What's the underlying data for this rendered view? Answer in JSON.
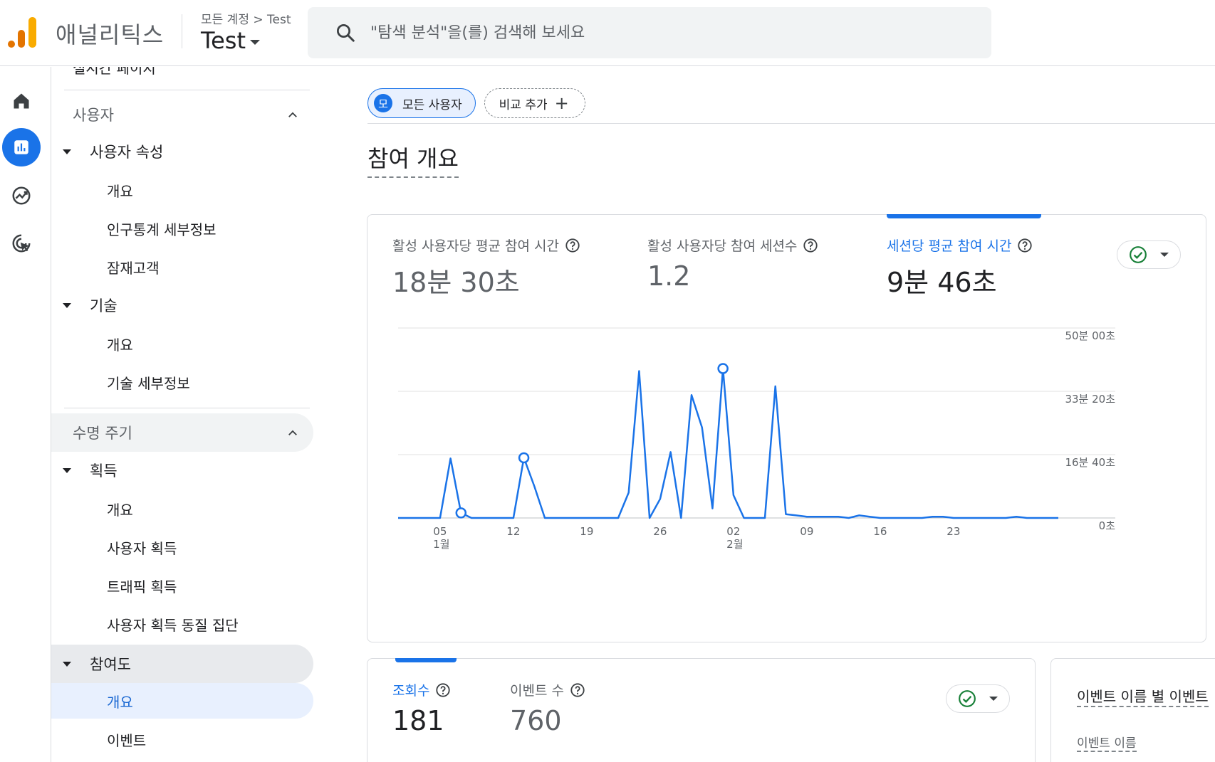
{
  "header": {
    "product_name": "애널리틱스",
    "breadcrumb_root": "모든 계정",
    "breadcrumb_separator": ">",
    "breadcrumb_account": "Test",
    "property_name": "Test",
    "search_placeholder": "\"탐색 분석\"을(를) 검색해 보세요"
  },
  "rail": {
    "items": [
      {
        "icon": "home-icon"
      },
      {
        "icon": "reports-icon",
        "active": true
      },
      {
        "icon": "explore-icon"
      },
      {
        "icon": "advertising-icon"
      }
    ]
  },
  "nav": {
    "cut_item": "실시간 페이지",
    "section_user": "사용자",
    "group_user_attributes": "사용자 속성",
    "user_attr_items": [
      "개요",
      "인구통계 세부정보",
      "잠재고객"
    ],
    "group_tech": "기술",
    "tech_items": [
      "개요",
      "기술 세부정보"
    ],
    "section_lifecycle": "수명 주기",
    "group_acquisition": "획득",
    "acq_items": [
      "개요",
      "사용자 획득",
      "트래픽 획득",
      "사용자 획득 동질 집단"
    ],
    "group_engagement": "참여도",
    "engagement_items": [
      "개요",
      "이벤트"
    ]
  },
  "main": {
    "chip_all_avatar": "모",
    "chip_all_label": "모든 사용자",
    "chip_add_label": "비교 추가",
    "chip_add_plus": "+",
    "page_title": "참여 개요"
  },
  "card1": {
    "metrics": [
      {
        "title": "활성 사용자당 평균 참여 시간",
        "value": "18분 30초"
      },
      {
        "title": "활성 사용자당 참여 세션수",
        "value": "1.2"
      },
      {
        "title": "세션당 평균 참여 시간",
        "value": "9분 46초",
        "selected": true
      }
    ]
  },
  "card2": {
    "metrics": [
      {
        "title": "조회수",
        "value": "181",
        "selected": true
      },
      {
        "title": "이벤트 수",
        "value": "760"
      }
    ]
  },
  "card3": {
    "title": "이벤트 이름 별 이벤트",
    "col_header": "이벤트 이름"
  },
  "colors": {
    "accent": "#1a73e8",
    "success": "#188038"
  },
  "chart_data": {
    "type": "line",
    "title": "",
    "xlabel": "",
    "ylabel": "",
    "y_unit": "seconds",
    "ylim": [
      0,
      3000
    ],
    "y_ticks": [
      {
        "value": 0,
        "label": "0초"
      },
      {
        "value": 1000,
        "label": "16분 40초"
      },
      {
        "value": 2000,
        "label": "33분 20초"
      },
      {
        "value": 3000,
        "label": "50분 00초"
      }
    ],
    "x_ticks": [
      {
        "index": 4,
        "label": "05",
        "sublabel": "1월"
      },
      {
        "index": 11,
        "label": "12"
      },
      {
        "index": 18,
        "label": "19"
      },
      {
        "index": 25,
        "label": "26"
      },
      {
        "index": 32,
        "label": "02",
        "sublabel": "2월"
      },
      {
        "index": 39,
        "label": "09"
      },
      {
        "index": 46,
        "label": "16"
      },
      {
        "index": 53,
        "label": "23"
      }
    ],
    "series": [
      {
        "values": [
          0,
          0,
          0,
          0,
          0,
          940,
          80,
          0,
          0,
          0,
          0,
          0,
          950,
          500,
          0,
          0,
          0,
          0,
          0,
          0,
          0,
          0,
          400,
          2320,
          0,
          300,
          1040,
          0,
          1940,
          1430,
          150,
          2360,
          360,
          0,
          0,
          0,
          2080,
          60,
          40,
          20,
          20,
          20,
          20,
          0,
          40,
          20,
          0,
          0,
          0,
          0,
          0,
          20,
          20,
          0,
          0,
          0,
          0,
          0,
          0,
          20,
          0,
          0,
          0,
          0
        ],
        "markers": [
          6,
          12,
          31
        ]
      }
    ]
  }
}
